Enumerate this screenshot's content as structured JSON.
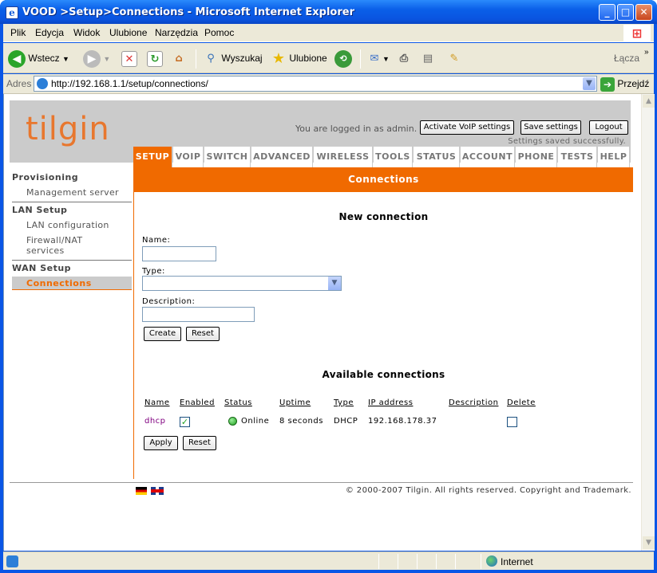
{
  "window": {
    "title": "VOOD >Setup>Connections - Microsoft Internet Explorer"
  },
  "menubar": {
    "items": [
      "Plik",
      "Edycja",
      "Widok",
      "Ulubione",
      "Narzędzia",
      "Pomoc"
    ]
  },
  "toolbar": {
    "back": "Wstecz",
    "search": "Wyszukaj",
    "favorites": "Ulubione",
    "links": "Łącza"
  },
  "address": {
    "label": "Adres",
    "url": "http://192.168.1.1/setup/connections/",
    "go": "Przejdź"
  },
  "statusbar": {
    "zone": "Internet"
  },
  "page": {
    "logo": "tilgin",
    "logged_in": "You are logged in as admin.",
    "buttons": {
      "voip": "Activate VoIP settings",
      "save": "Save settings",
      "logout": "Logout"
    },
    "saved_msg": "Settings saved successfully.",
    "tabs": [
      "SETUP",
      "VOIP",
      "SWITCH",
      "ADVANCED",
      "WIRELESS",
      "TOOLS",
      "STATUS",
      "ACCOUNT",
      "PHONE",
      "TESTS",
      "HELP"
    ],
    "nav": {
      "provisioning": "Provisioning",
      "management_server": "Management server",
      "lan_setup": "LAN Setup",
      "lan_configuration": "LAN configuration",
      "firewall_1": "Firewall/NAT",
      "firewall_2": "services",
      "wan_setup": "WAN Setup",
      "connections": "Connections"
    },
    "section_title": "Connections",
    "new_connection": {
      "heading": "New connection",
      "name_label": "Name:",
      "name_value": "",
      "type_label": "Type:",
      "type_value": "",
      "description_label": "Description:",
      "description_value": "",
      "create": "Create",
      "reset": "Reset"
    },
    "available": {
      "heading": "Available connections",
      "columns": [
        "Name",
        "Enabled",
        "Status",
        "Uptime",
        "Type",
        "IP address",
        "Description",
        "Delete"
      ],
      "rows": [
        {
          "name": "dhcp",
          "enabled": true,
          "status": "Online",
          "uptime": "8 seconds",
          "type": "DHCP",
          "ip": "192.168.178.37",
          "description": "",
          "delete": false
        }
      ],
      "apply": "Apply",
      "reset": "Reset"
    },
    "copyright": "© 2000-2007 Tilgin. All rights reserved. Copyright and Trademark."
  },
  "colors": {
    "accent": "#f06a00",
    "header_bg": "#cbcbcb",
    "logo": "#e8772e"
  }
}
